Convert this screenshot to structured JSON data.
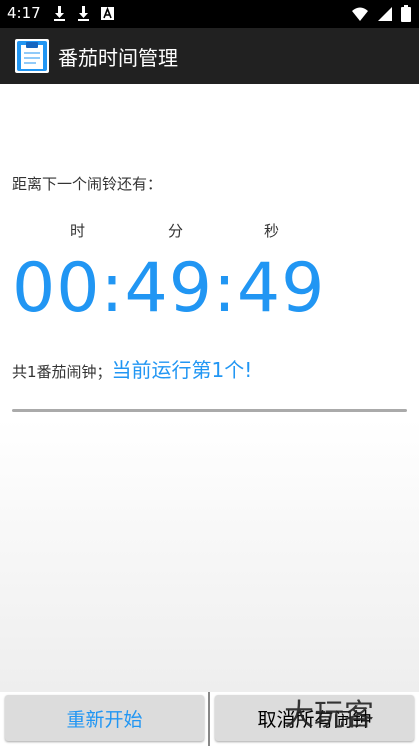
{
  "status_bar": {
    "time": "4:17",
    "icons": [
      "download-icon",
      "download-icon",
      "font-icon",
      "wifi-icon",
      "signal-icon",
      "battery-icon"
    ]
  },
  "app_bar": {
    "title": "番茄时间管理",
    "icon": "clipboard-icon"
  },
  "countdown": {
    "label": "距离下一个闹铃还有：",
    "units": {
      "hour": "时",
      "minute": "分",
      "second": "秒"
    },
    "time": "00:49:49"
  },
  "summary": {
    "total": "共1番茄闹钟；",
    "current": "当前运行第1个!"
  },
  "progress": {
    "value": 0
  },
  "buttons": {
    "restart": "重新开始",
    "cancel_all": "取消所有闹钟"
  },
  "watermark": "大玩客",
  "colors": {
    "accent": "#2196f3",
    "app_bar": "#212121",
    "status_bar": "#000000",
    "button": "#dcdcdc"
  }
}
